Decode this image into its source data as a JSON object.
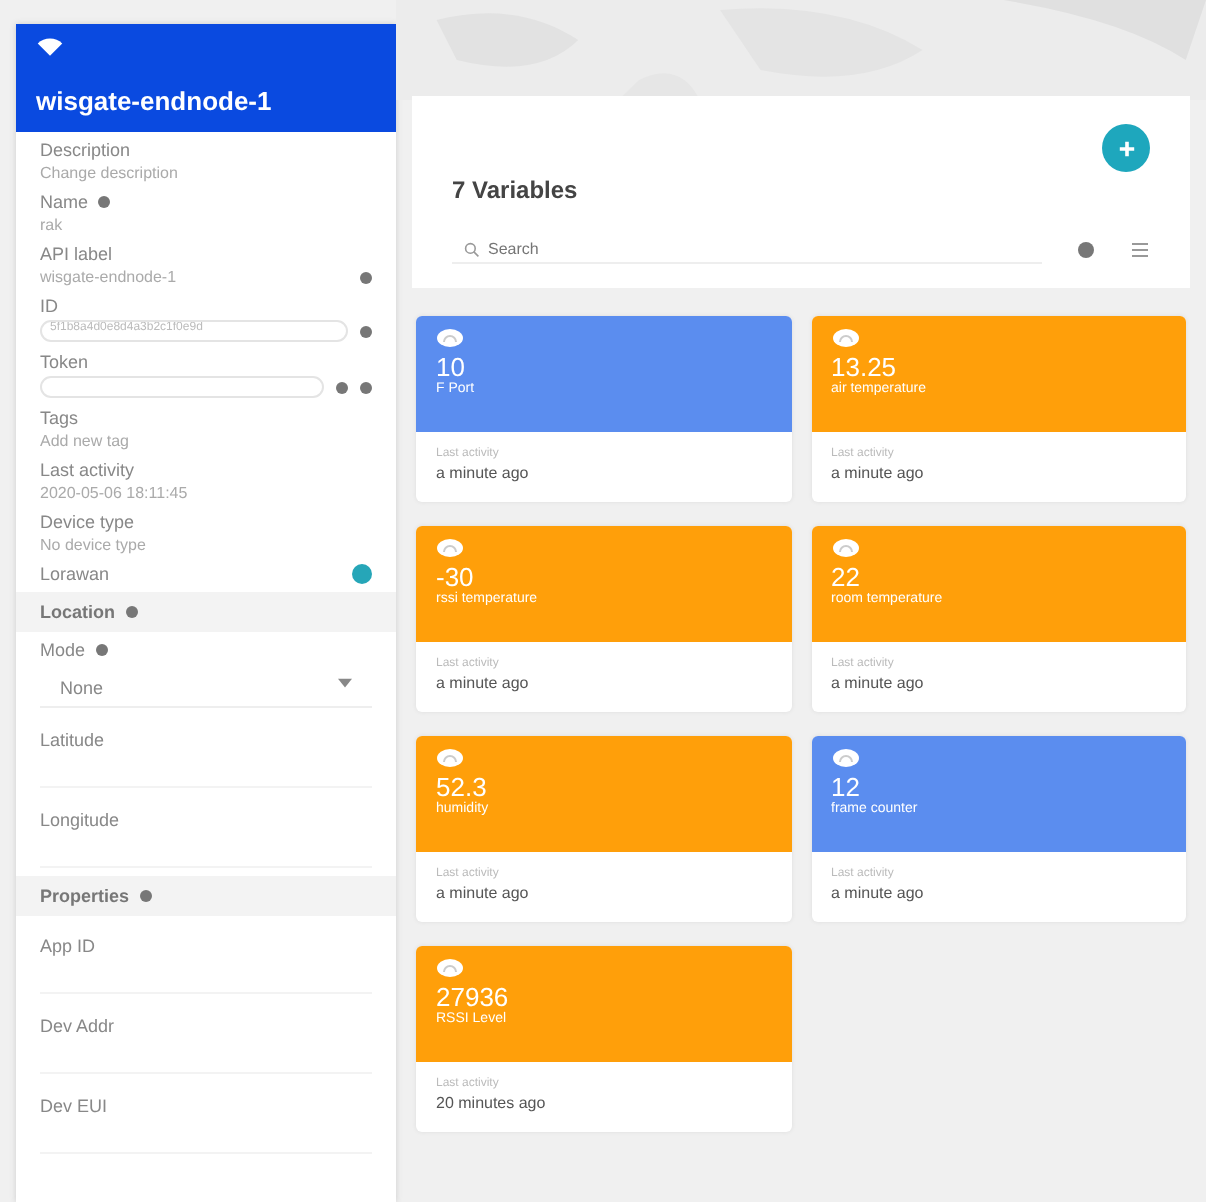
{
  "device": {
    "name": "wisgate-endnode-1"
  },
  "fields": [
    {
      "label": "Description",
      "value": "Change description",
      "kind": "text"
    },
    {
      "label": "Name",
      "value": "rak",
      "kind": "text",
      "info": true
    },
    {
      "label": "API label",
      "value": "wisgate-endnode-1",
      "kind": "text",
      "copyable": true
    },
    {
      "label": "ID",
      "value": "5f1b8a4d0e8d4a3b2c1f0e9d",
      "kind": "boxed",
      "copyable": true
    },
    {
      "label": "Token",
      "kind": "boxed",
      "copyable": true,
      "hidden": true
    },
    {
      "label": "Tags",
      "value": "Add new tag",
      "kind": "text"
    },
    {
      "label": "Last activity",
      "value": "2020-05-06 18:11:45",
      "kind": "text"
    },
    {
      "label": "Device type",
      "value": "No device type",
      "kind": "text"
    },
    {
      "label": "Lorawan",
      "kind": "toggle",
      "on": true
    }
  ],
  "location": {
    "title": "Location",
    "mode_label": "Mode",
    "mode": "None",
    "fields": [
      "Latitude",
      "Longitude"
    ]
  },
  "properties": {
    "title": "Properties",
    "fields": [
      "App ID",
      "Dev Addr",
      "Dev EUI"
    ]
  },
  "variables": {
    "title": "7 Variables",
    "search": {
      "placeholder": "Search"
    },
    "cards": [
      {
        "value": "10",
        "name": "F Port",
        "color": "#5b8def",
        "activity_label": "Last activity",
        "time": "a minute ago"
      },
      {
        "value": "13.25",
        "name": "air temperature",
        "color": "#ff9f0a",
        "activity_label": "Last activity",
        "time": "a minute ago"
      },
      {
        "value": "-30",
        "name": "rssi temperature",
        "color": "#ff9f0a",
        "activity_label": "Last activity",
        "time": "a minute ago"
      },
      {
        "value": "22",
        "name": "room temperature",
        "color": "#ff9f0a",
        "activity_label": "Last activity",
        "time": "a minute ago"
      },
      {
        "value": "52.3",
        "name": "humidity",
        "color": "#ff9f0a",
        "activity_label": "Last activity",
        "time": "a minute ago"
      },
      {
        "value": "12",
        "name": "frame counter",
        "color": "#5b8def",
        "activity_label": "Last activity",
        "time": "a minute ago"
      },
      {
        "value": "27936",
        "name": "RSSI Level",
        "color": "#ff9f0a",
        "activity_label": "Last activity",
        "time": "20 minutes ago"
      }
    ]
  }
}
